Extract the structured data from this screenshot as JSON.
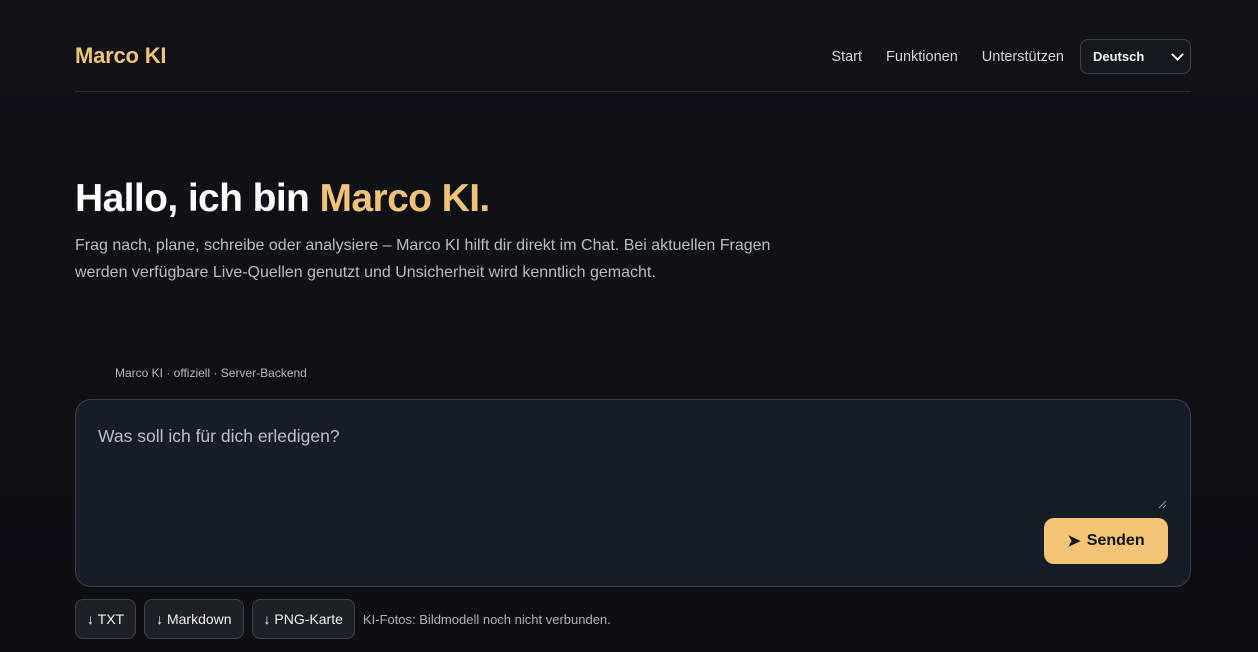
{
  "header": {
    "brand": "Marco KI",
    "nav": [
      "Start",
      "Funktionen",
      "Unterstützen"
    ],
    "language": {
      "selected": "Deutsch",
      "icon": "chevron-down-icon"
    }
  },
  "hero": {
    "title_prefix": "Hallo, ich bin ",
    "title_accent": "Marco KI.",
    "description": "Frag nach, plane, schreibe oder analysiere – Marco KI hilft dir direkt im Chat. Bei aktuellen Fragen werden verfügbare Live-Quellen genutzt und Unsicherheit wird kenntlich gemacht."
  },
  "chat": {
    "meta": "Marco KI · offiziell · Server-Backend",
    "placeholder": "Was soll ich für dich erledigen?",
    "send_icon": "➤",
    "send_label": "Senden"
  },
  "downloads": {
    "txt": "↓ TXT",
    "markdown": "↓ Markdown",
    "png": "↓ PNG-Karte",
    "note": "KI-Fotos: Bildmodell noch nicht verbunden."
  },
  "colors": {
    "accent": "#f1c27a",
    "button": "#f4c576",
    "background": "#0d1117",
    "panel": "#171d26"
  }
}
